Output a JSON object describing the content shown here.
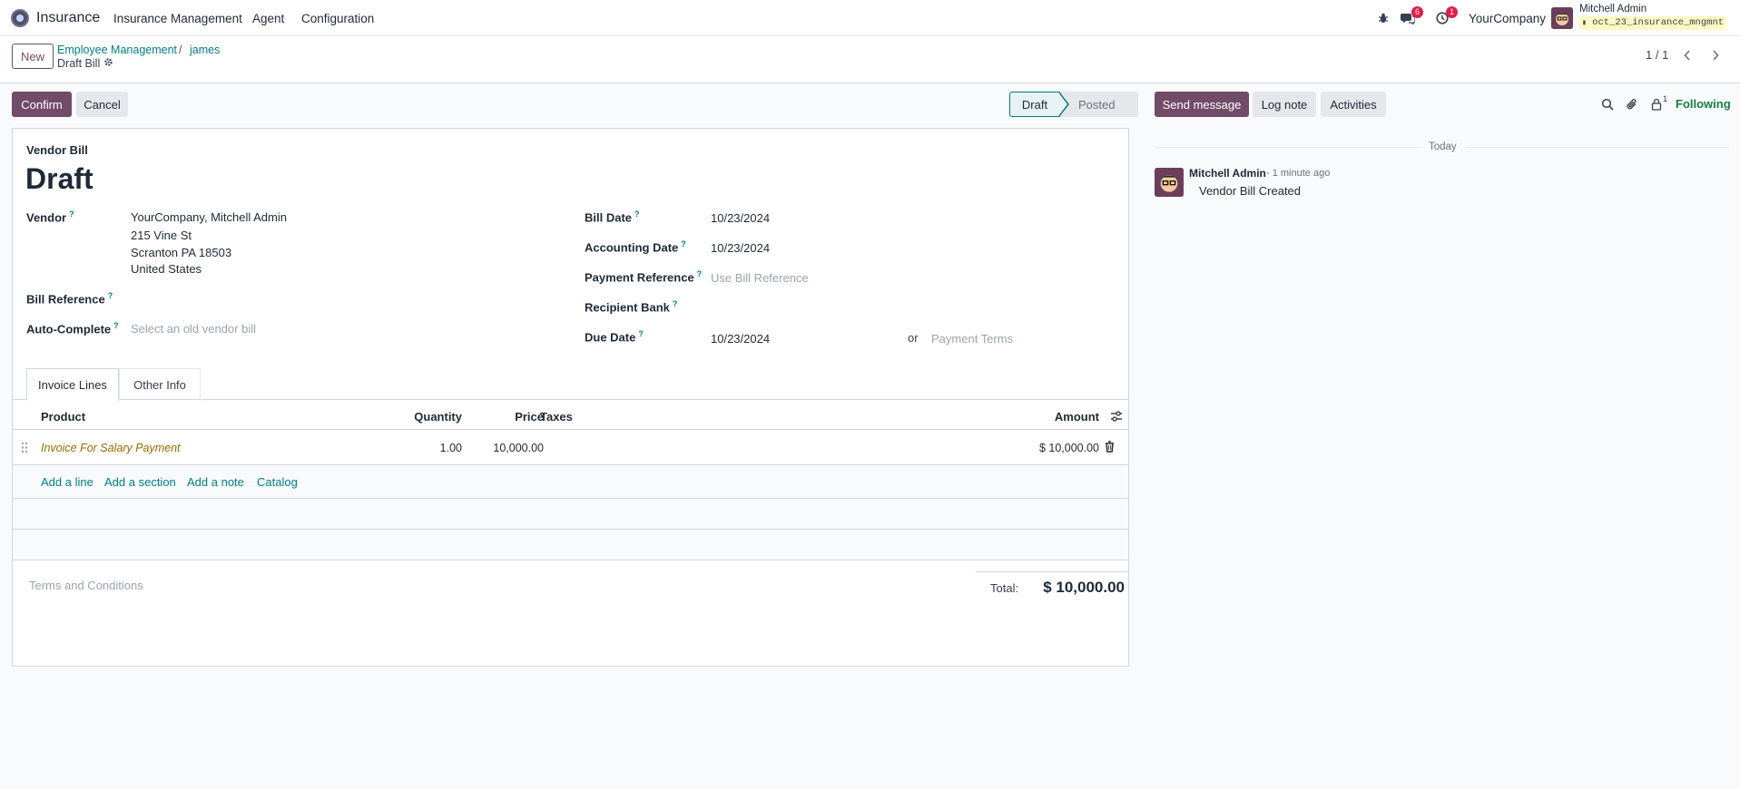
{
  "navbar": {
    "app_name": "Insurance",
    "menu": [
      "Insurance Management",
      "Agent",
      "Configuration"
    ],
    "messages_badge": "6",
    "activities_badge": "1",
    "company": "YourCompany",
    "user_name": "Mitchell Admin",
    "database": "oct_23_insurance_mngmnt"
  },
  "control": {
    "new_label": "New",
    "breadcrumb": [
      "Employee Management",
      "james"
    ],
    "breadcrumb_sep": "/",
    "current": "Draft Bill",
    "pager": "1 / 1"
  },
  "actions": {
    "confirm": "Confirm",
    "cancel": "Cancel"
  },
  "status": {
    "steps": [
      "Draft",
      "Posted"
    ],
    "active": "Draft"
  },
  "form": {
    "type": "Vendor Bill",
    "title": "Draft",
    "left_fields": {
      "vendor_label": "Vendor",
      "vendor_lines": [
        "YourCompany, Mitchell Admin",
        "215 Vine St",
        "Scranton PA 18503",
        "United States"
      ],
      "bill_reference_label": "Bill Reference",
      "auto_complete_label": "Auto-Complete",
      "auto_complete_placeholder": "Select an old vendor bill"
    },
    "right_fields": {
      "bill_date_label": "Bill Date",
      "bill_date": "10/23/2024",
      "accounting_date_label": "Accounting Date",
      "accounting_date": "10/23/2024",
      "payment_reference_label": "Payment Reference",
      "payment_reference_placeholder": "Use Bill Reference",
      "recipient_bank_label": "Recipient Bank",
      "due_date_label": "Due Date",
      "due_date": "10/23/2024",
      "or_label": "or",
      "payment_terms_placeholder": "Payment Terms"
    },
    "tabs": [
      "Invoice Lines",
      "Other Info"
    ],
    "columns": {
      "product": "Product",
      "quantity": "Quantity",
      "price": "Price",
      "taxes": "Taxes",
      "amount": "Amount"
    },
    "lines": [
      {
        "product": "Invoice For Salary Payment",
        "quantity": "1.00",
        "price": "10,000.00",
        "taxes": "",
        "amount": "$ 10,000.00"
      }
    ],
    "add_links": [
      "Add a line",
      "Add a section",
      "Add a note",
      "Catalog"
    ],
    "terms_placeholder": "Terms and Conditions",
    "total_label": "Total:",
    "total_value": "$ 10,000.00"
  },
  "chatter": {
    "send_message": "Send message",
    "log_note": "Log note",
    "activities": "Activities",
    "followers_count": "1",
    "following": "Following",
    "date_separator": "Today",
    "message": {
      "author": "Mitchell Admin",
      "time": "- 1 minute ago",
      "body": "Vendor Bill Created"
    }
  },
  "colors": {
    "brand": "#714b67",
    "link": "#017e84",
    "badge": "#e11d48",
    "following": "#15803d"
  }
}
